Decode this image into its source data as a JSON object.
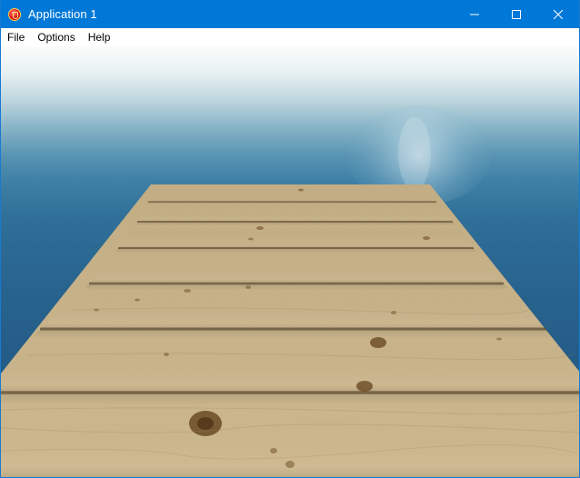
{
  "window": {
    "title": "Application 1",
    "icon": "app-icon",
    "controls": [
      "minimize-icon",
      "maximize-icon",
      "close-icon"
    ]
  },
  "menu": {
    "items": [
      {
        "label": "File"
      },
      {
        "label": "Options"
      },
      {
        "label": "Help"
      }
    ]
  },
  "scene": {
    "description_icon": "3d-viewport",
    "colors": {
      "water_top": "#fbfcfc",
      "water_deep": "#1f527c",
      "plank_light": "#c9b48a",
      "plank_dark": "#a89064",
      "gap": "#5c4a30"
    }
  }
}
